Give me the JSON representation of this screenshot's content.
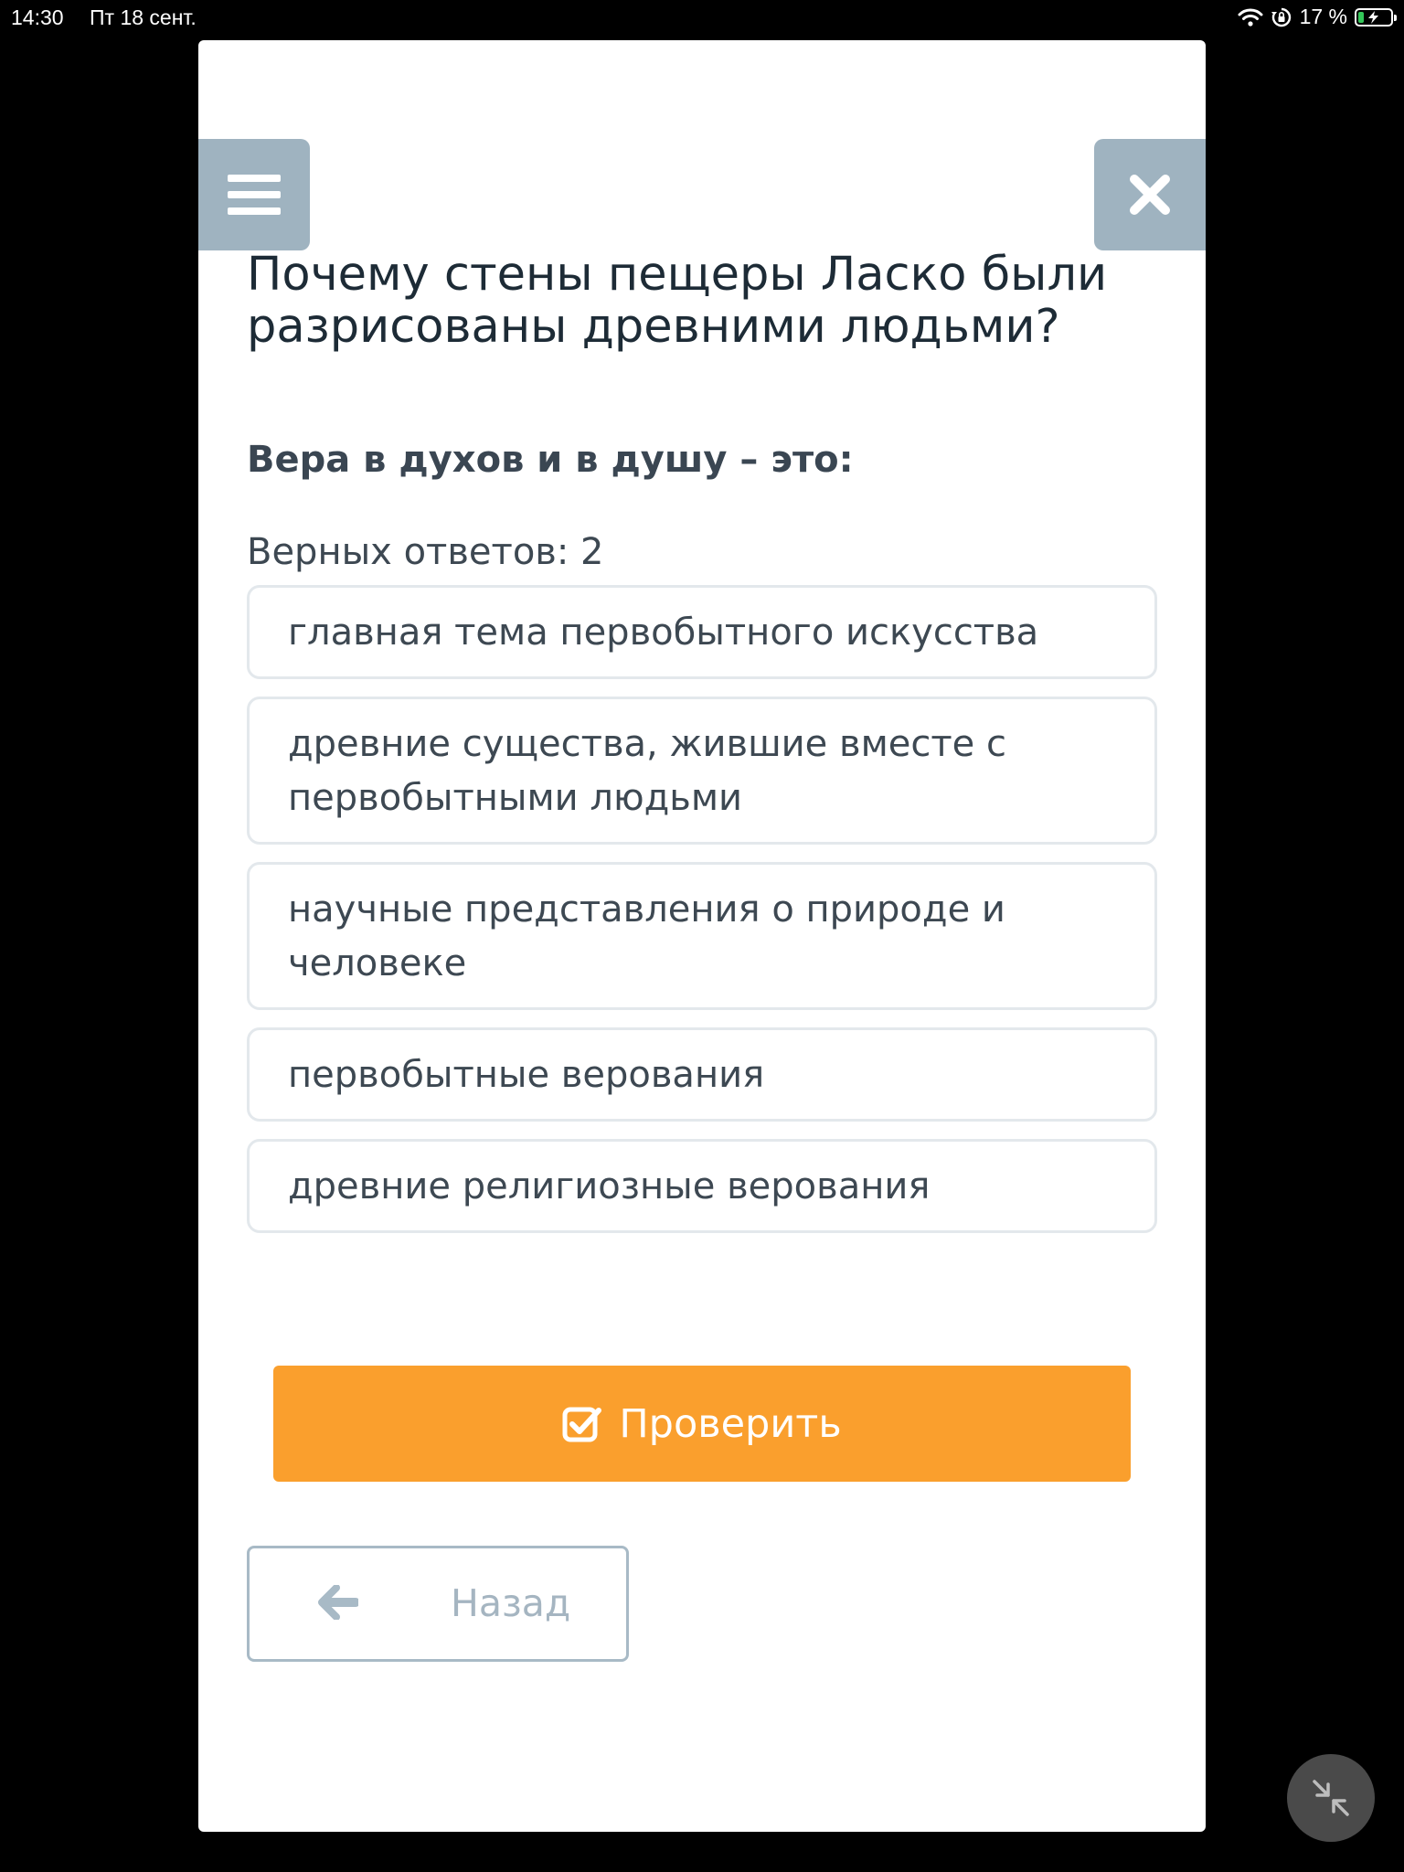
{
  "status_bar": {
    "time": "14:30",
    "date": "Пт 18 сент.",
    "battery_text": "17 %",
    "battery_level": 0.17
  },
  "quiz": {
    "title": "Почему стены пещеры Ласко были разрисованы древними людьми?",
    "question": "Вера в духов и в душу – это:",
    "correct_count_label": "Верных ответов: 2",
    "options": [
      "главная тема первобытного искусства",
      "древние существа, жившие вместе с первобытными людьми",
      "научные представления о природе и человеке",
      "первобытные верования",
      "древние религиозные верования"
    ],
    "check_button_label": "Проверить",
    "back_button_label": "Назад"
  },
  "colors": {
    "check_button": "#fa9f2d",
    "side_buttons": "#9fb3c0",
    "background": "#000000"
  },
  "icons": [
    "menu-icon",
    "close-icon",
    "checkbox-checked-icon",
    "arrow-left-icon",
    "collapse-icon",
    "wifi-icon",
    "orientation-lock-icon",
    "battery-charging-icon"
  ]
}
